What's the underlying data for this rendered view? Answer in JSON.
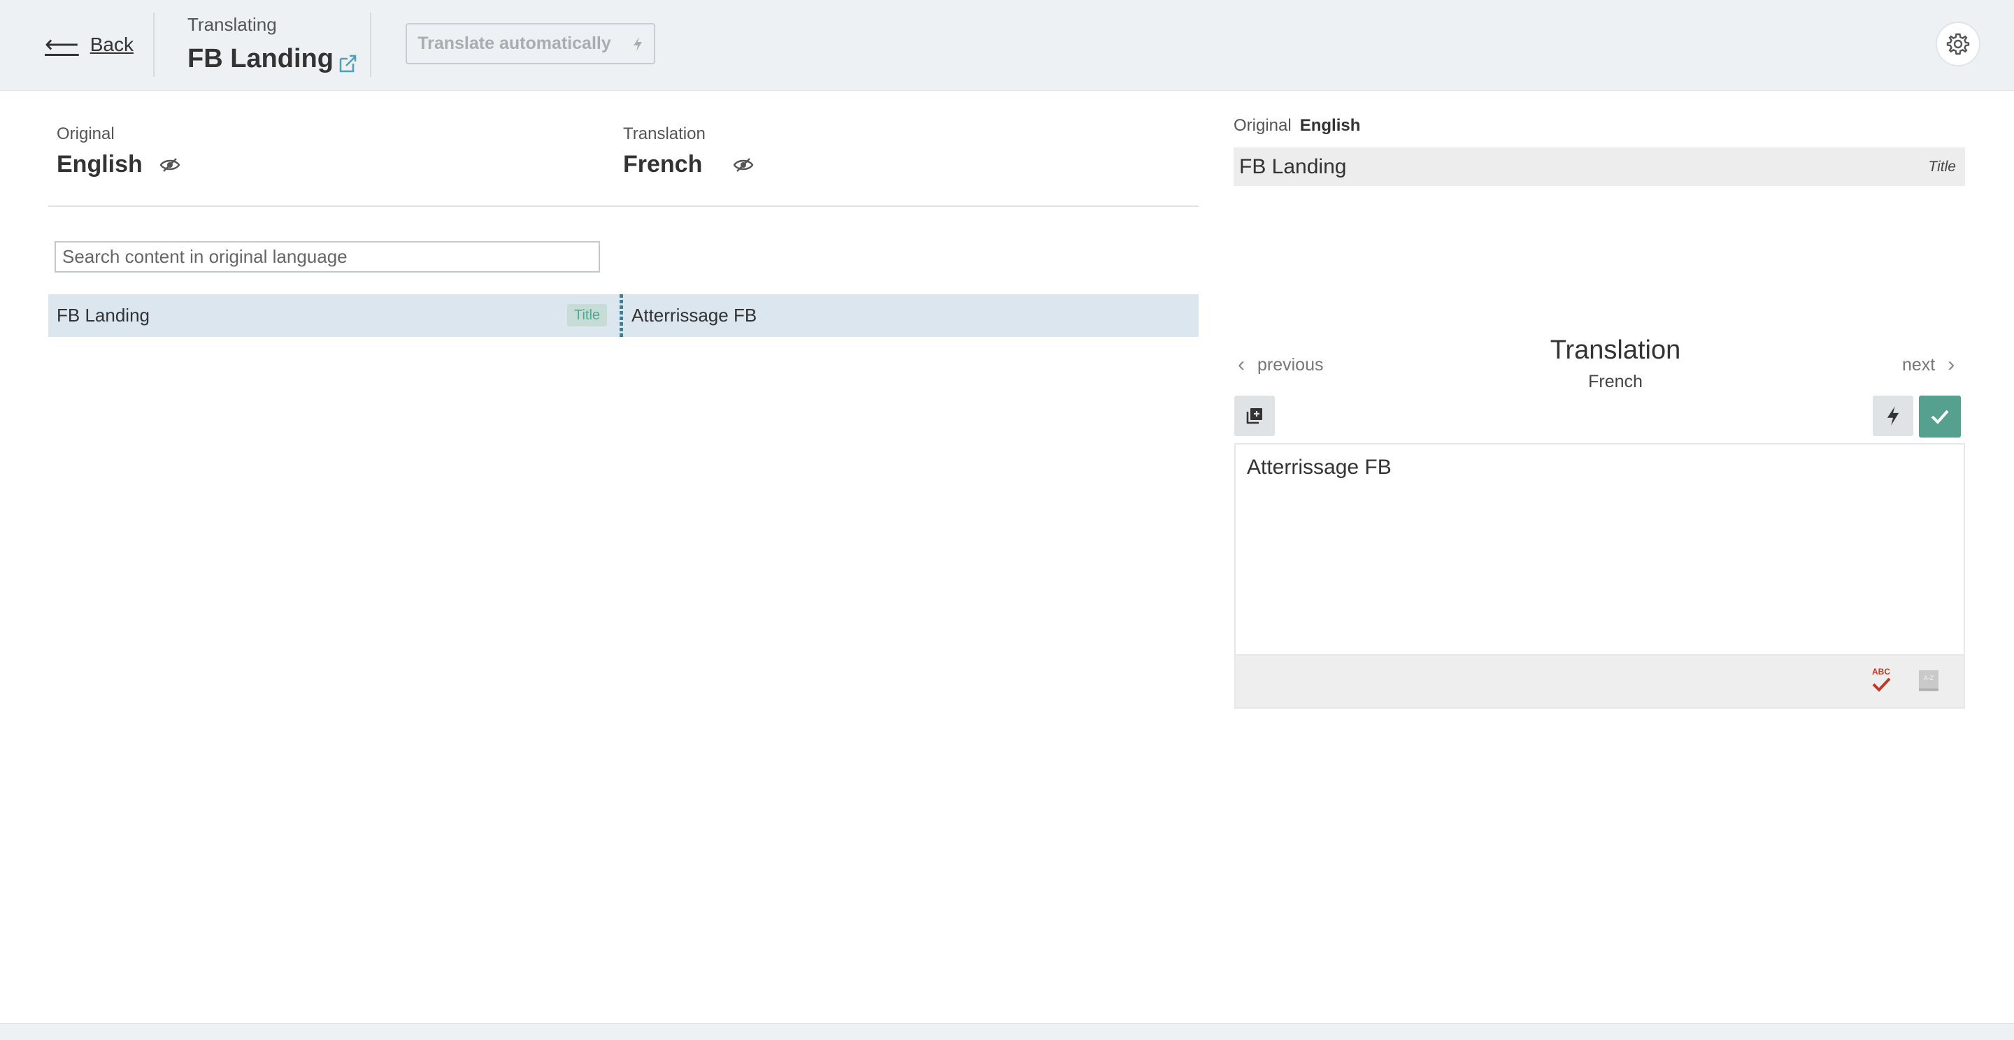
{
  "header": {
    "back_label": "Back",
    "overline": "Translating",
    "project_title": "FB Landing",
    "auto_translate_label": "Translate automatically"
  },
  "columns": {
    "original": {
      "label": "Original",
      "language": "English"
    },
    "translation": {
      "label": "Translation",
      "language": "French"
    }
  },
  "search": {
    "placeholder": "Search content in original language",
    "value": ""
  },
  "rows": [
    {
      "original": "FB Landing",
      "tag": "Title",
      "translation": "Atterrissage FB"
    }
  ],
  "panel": {
    "original_label": "Original",
    "original_language": "English",
    "original_text": "FB Landing",
    "original_tag": "Title",
    "prev_label": "previous",
    "next_label": "next",
    "translation_title": "Translation",
    "translation_language": "French",
    "translation_value": "Atterrissage FB",
    "spellcheck_icon_text": "ABC",
    "dictionary_icon_text": "A-Z"
  },
  "colors": {
    "header_bg": "#edf1f4",
    "row_selected_bg": "#dbe6ef",
    "accent_green": "#56a08f",
    "separator_blue": "#3f7e98",
    "spellcheck_red": "#c0392b"
  },
  "icons": [
    "arrow-left-icon",
    "external-link-icon",
    "bolt-icon",
    "gear-icon",
    "eye-off-icon",
    "chevron-left-icon",
    "chevron-right-icon",
    "copy-icon",
    "check-icon",
    "spellcheck-icon",
    "dictionary-icon"
  ]
}
